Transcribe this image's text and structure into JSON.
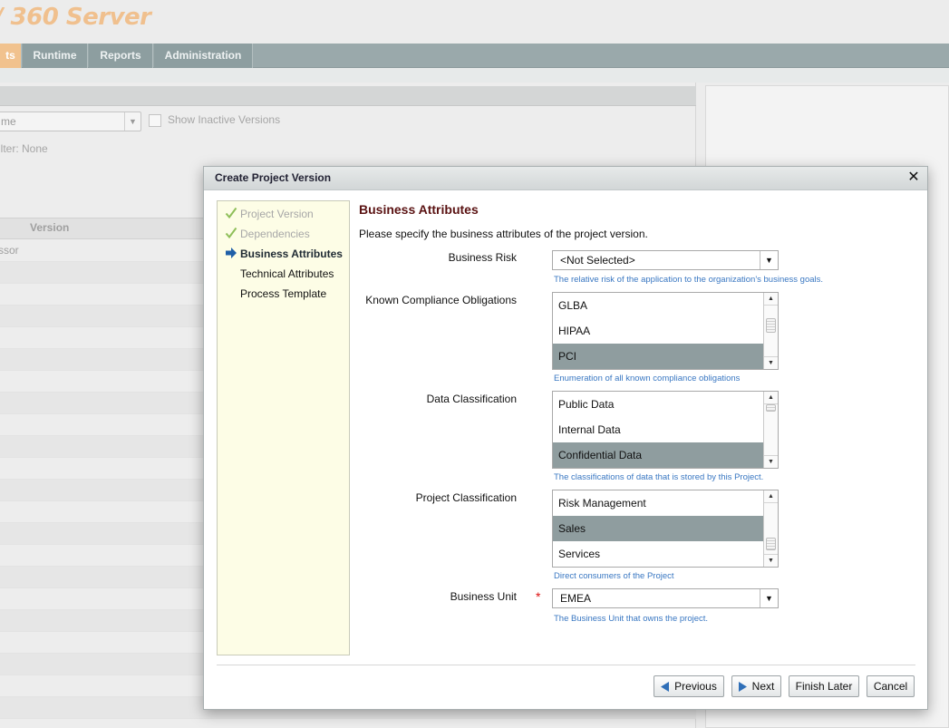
{
  "app": {
    "title": "360 Server",
    "tabs": [
      {
        "label": "ts"
      },
      {
        "label": "Runtime"
      },
      {
        "label": "Reports"
      },
      {
        "label": "Administration"
      }
    ]
  },
  "background": {
    "select_value": "me",
    "show_inactive_label": "Show Inactive Versions",
    "filter_text": "ilter: None",
    "table_header_version": "Version",
    "row_text": "ssor"
  },
  "dialog": {
    "title": "Create Project Version",
    "close_glyph": "✕",
    "steps": [
      {
        "label": "Project Version",
        "state": "done"
      },
      {
        "label": "Dependencies",
        "state": "done"
      },
      {
        "label": "Business Attributes",
        "state": "current"
      },
      {
        "label": "Technical Attributes",
        "state": "todo"
      },
      {
        "label": "Process Template",
        "state": "todo"
      }
    ],
    "heading": "Business Attributes",
    "description": "Please specify the business attributes of the project version.",
    "fields": {
      "business_risk": {
        "label": "Business Risk",
        "value": "<Not Selected>",
        "help": "The relative risk of the application to the organization's business goals."
      },
      "compliance": {
        "label": "Known Compliance Obligations",
        "options": [
          "GLBA",
          "HIPAA",
          "PCI"
        ],
        "selected": "PCI",
        "help": "Enumeration of all known compliance obligations"
      },
      "data_classification": {
        "label": "Data Classification",
        "options": [
          "Public Data",
          "Internal Data",
          "Confidential Data"
        ],
        "selected": "Confidential Data",
        "help": "The classifications of data that is stored by this Project."
      },
      "project_classification": {
        "label": "Project Classification",
        "options": [
          "Risk Management",
          "Sales",
          "Services"
        ],
        "selected": "Sales",
        "help": "Direct consumers of the Project"
      },
      "business_unit": {
        "label": "Business Unit",
        "required_mark": "*",
        "value": "EMEA",
        "help": "The Business Unit that owns the project."
      }
    },
    "buttons": {
      "previous": "Previous",
      "next": "Next",
      "finish_later": "Finish Later",
      "cancel": "Cancel"
    }
  },
  "colors": {
    "selected_option": "#8f9d9f",
    "help_text": "#3977c2",
    "heading": "#5a1212",
    "steps_bg": "#fdfde6",
    "check_done": "#8fbf5a",
    "arrow_current": "#1f5fa8"
  }
}
